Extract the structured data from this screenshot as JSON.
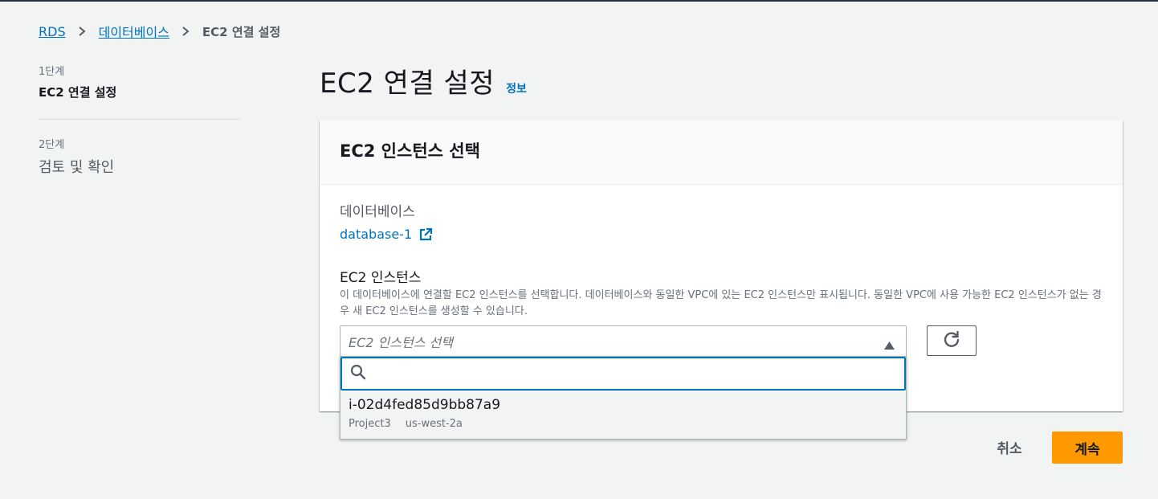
{
  "colors": {
    "link": "#0073bb",
    "primary_button": "#ff9900",
    "page_background": "#f2f3f3",
    "text_primary": "#16191f",
    "text_secondary": "#687078"
  },
  "breadcrumb": {
    "items": [
      {
        "label": "RDS",
        "link": true
      },
      {
        "label": "데이터베이스",
        "link": true
      },
      {
        "label": "EC2 연결 설정",
        "link": false
      }
    ],
    "separator_icon": "chevron-right-icon"
  },
  "steps": {
    "items": [
      {
        "number": "1단계",
        "title": "EC2 연결 설정",
        "active": true
      },
      {
        "number": "2단계",
        "title": "검토 및 확인",
        "active": false
      }
    ]
  },
  "header": {
    "title": "EC2 연결 설정",
    "info_link": "정보"
  },
  "panel": {
    "title": "EC2 인스턴스 선택",
    "database_label": "데이터베이스",
    "database_name": "database-1",
    "database_link_icon": "external-link-icon",
    "ec2_label": "EC2 인스턴스",
    "ec2_description": "이 데이터베이스에 연결할 EC2 인스턴스를 선택합니다. 데이터베이스와 동일한 VPC에 있는 EC2 인스턴스만 표시됩니다. 동일한 VPC에 사용 가능한 EC2 인스턴스가 없는 경우 새 EC2 인스턴스를 생성할 수 있습니다.",
    "select_placeholder": "EC2 인스턴스 선택",
    "select_icon": "caret-up-icon",
    "refresh_icon": "refresh-icon"
  },
  "dropdown": {
    "search_value": "",
    "search_icon": "search-icon",
    "options": [
      {
        "id": "i-02d4fed85d9bb87a9",
        "tags": [
          "Project3",
          "us-west-2a"
        ]
      }
    ]
  },
  "footer": {
    "cancel_label": "취소",
    "continue_label": "계속"
  }
}
